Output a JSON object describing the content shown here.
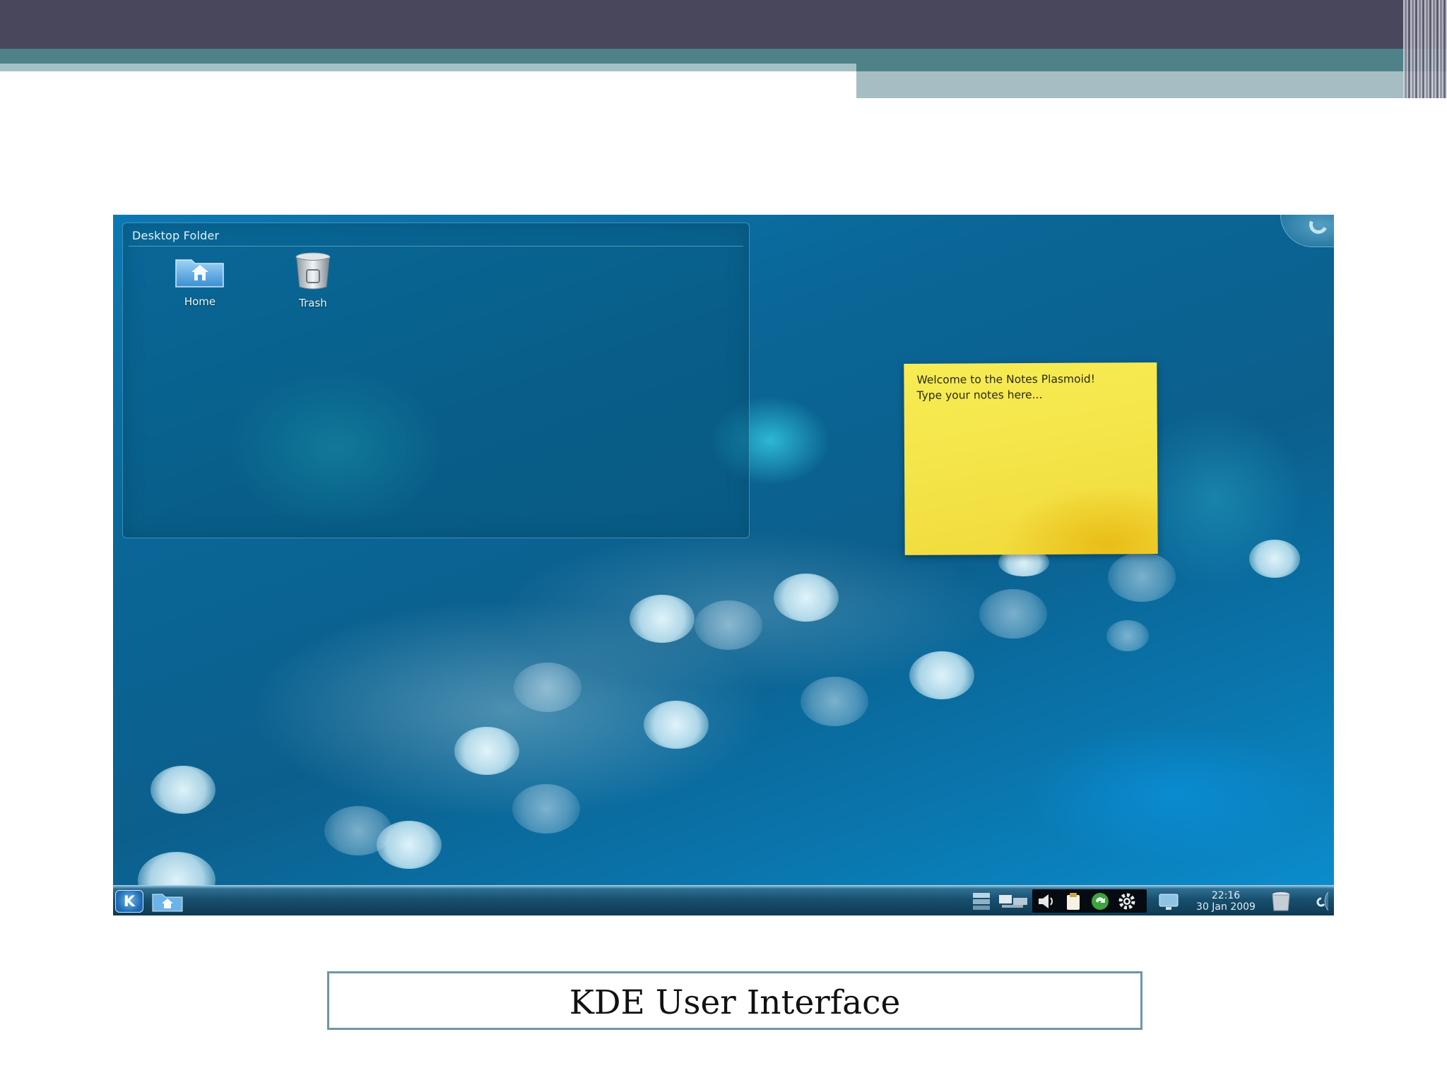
{
  "slide": {
    "caption": "KDE User Interface",
    "colors": {
      "top_bar": "#48475c",
      "teal_bar": "#4f8288",
      "caption_border": "#6f95ab"
    }
  },
  "desktop": {
    "folder_view": {
      "title": "Desktop Folder",
      "icons": [
        {
          "label": "Home",
          "icon": "home-folder-icon"
        },
        {
          "label": "Trash",
          "icon": "trash-icon"
        }
      ]
    },
    "note": {
      "text": "Welcome to the Notes Plasmoid!\nType your notes here..."
    },
    "taskbar": {
      "kickoff_label": "K",
      "clock_time": "22:16",
      "clock_date": "30 Jan 2009",
      "tray_icons": [
        "pager-icon",
        "taskbar-icon",
        "volume-icon",
        "clipboard-icon",
        "update-icon",
        "settings-gear-icon",
        "network-icon"
      ]
    },
    "colors": {
      "wallpaper": "#0b6fa3",
      "note": "#f4e54a",
      "note_shadow": "#e9bd18"
    }
  }
}
